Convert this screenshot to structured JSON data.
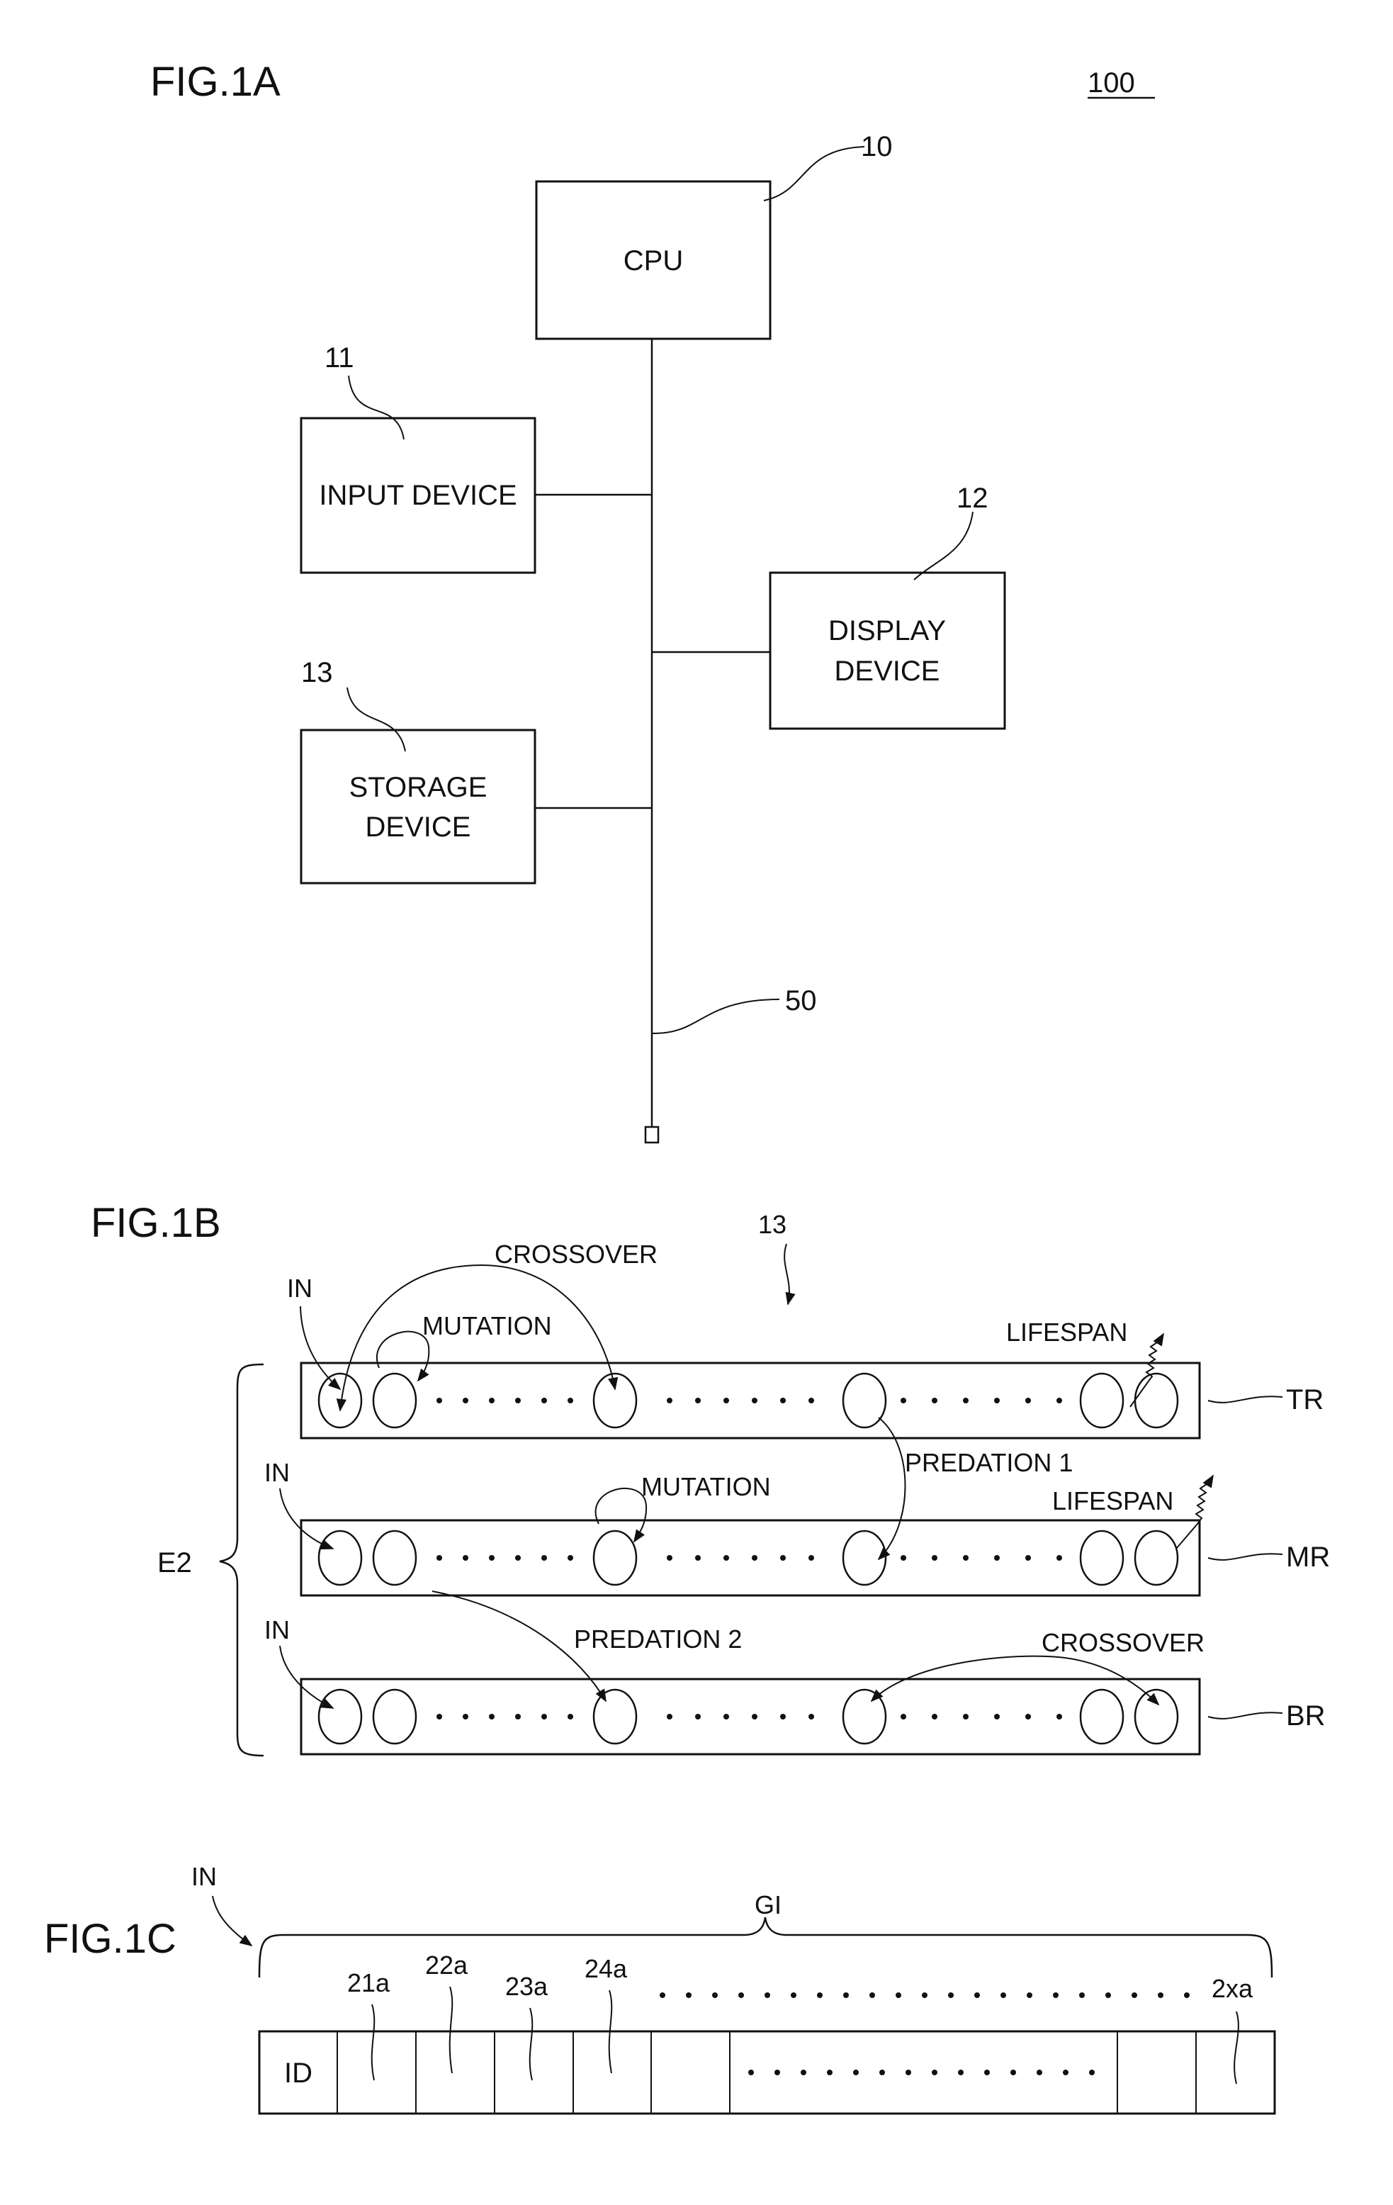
{
  "fig1a": {
    "title": "FIG.1A",
    "system_ref": "100",
    "blocks": [
      {
        "id": "cpu",
        "ref": "10",
        "lines": [
          "CPU"
        ]
      },
      {
        "id": "input",
        "ref": "11",
        "lines": [
          "INPUT DEVICE"
        ]
      },
      {
        "id": "display",
        "ref": "12",
        "lines": [
          "DISPLAY",
          "DEVICE"
        ]
      },
      {
        "id": "storage",
        "ref": "13",
        "lines": [
          "STORAGE",
          "DEVICE"
        ]
      }
    ],
    "bus_ref": "50"
  },
  "fig1b": {
    "title": "FIG.1B",
    "ref": "13",
    "group_label": "E2",
    "rows": [
      {
        "id": "TR",
        "label": "TR",
        "in_label": "IN"
      },
      {
        "id": "MR",
        "label": "MR",
        "in_label": "IN"
      },
      {
        "id": "BR",
        "label": "BR",
        "in_label": "IN"
      }
    ],
    "annotations": {
      "crossover_top": "CROSSOVER",
      "mutation_top": "MUTATION",
      "lifespan_top": "LIFESPAN",
      "predation1": "PREDATION 1",
      "mutation_mid": "MUTATION",
      "lifespan_mid": "LIFESPAN",
      "predation2": "PREDATION 2",
      "crossover_bottom": "CROSSOVER"
    }
  },
  "fig1c": {
    "title": "FIG.1C",
    "in_label": "IN",
    "brace_label": "GI",
    "id_cell": "ID",
    "gene_refs": [
      "21a",
      "22a",
      "23a",
      "24a"
    ],
    "last_gene_ref": "2xa"
  }
}
